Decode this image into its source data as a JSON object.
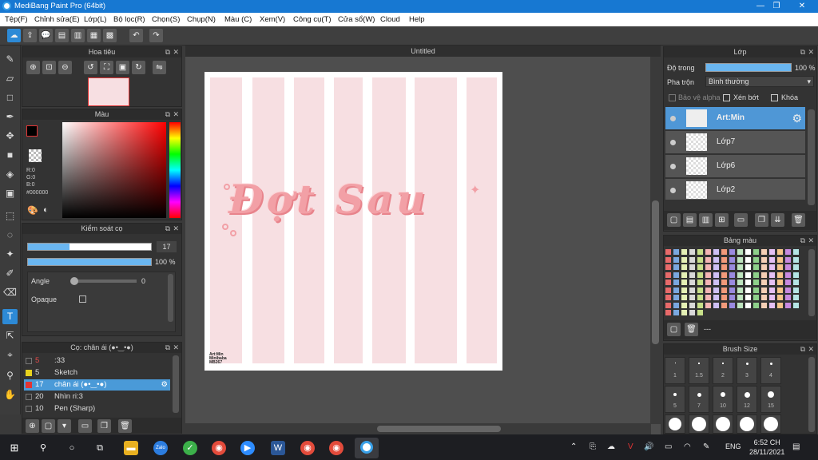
{
  "window": {
    "title": "MediBang Paint Pro (64bit)",
    "min": "—",
    "max": "❐",
    "close": "✕"
  },
  "menu": [
    "Tệp(F)",
    "Chỉnh sửa(E)",
    "Lớp(L)",
    "Bộ lọc(R)",
    "Chọn(S)",
    "Chụp(N)",
    "Màu (C)",
    "Xem(V)",
    "Công cụ(T)",
    "Cửa sổ(W)",
    "Cloud",
    "Help"
  ],
  "toolbar_icons": [
    "cloud-icon",
    "share-icon",
    "chat-icon",
    "comment-icon",
    "document-icon",
    "gallery-icon",
    "grid-icon",
    "undo-icon",
    "redo-icon"
  ],
  "navigator": {
    "title": "Hoa tiêu"
  },
  "color": {
    "title": "Màu",
    "r": "R:0",
    "g": "G:0",
    "b": "B:0",
    "hex": "#000000"
  },
  "brush_control": {
    "title": "Kiểm soát cọ",
    "size": "17",
    "opacity": "100 %",
    "angle_label": "Angle",
    "angle_value": "0",
    "opaque_label": "Opaque"
  },
  "brush_list": {
    "title": "Cọ: chân ái (●•‿•●)",
    "items": [
      {
        "size": "5",
        "name": ":33",
        "color": "#333333"
      },
      {
        "size": "5",
        "name": "Sketch",
        "color": "#e8d21e"
      },
      {
        "size": "17",
        "name": "chân ái (●•‿•●)",
        "color": "#e23434"
      },
      {
        "size": "20",
        "name": "Nhìn ri:3",
        "color": "#333333"
      },
      {
        "size": "10",
        "name": "Pen (Sharp)",
        "color": "#333333"
      }
    ]
  },
  "canvas": {
    "title": "Untitled",
    "art_text": "Đợt Sau",
    "signature": "Art:Min\nMinibaba\nMB267"
  },
  "layers": {
    "title": "Lớp",
    "opacity_label": "Độ trong",
    "opacity_value": "100 %",
    "blend_label": "Pha trộn",
    "blend_value": "Bình thường",
    "alpha_protect": "Bảo vệ alpha",
    "clipping": "Xén bớt",
    "lock": "Khóa",
    "items": [
      "Art:Min",
      "Lớp7",
      "Lớp6",
      "Lớp2"
    ]
  },
  "palette": {
    "title": "Bảng màu",
    "footer": "---"
  },
  "brush_size": {
    "title": "Brush Size",
    "sizes": [
      "1",
      "1.5",
      "2",
      "3",
      "4",
      "5",
      "7",
      "10",
      "12",
      "15"
    ]
  },
  "taskbar": {
    "time": "6:52 CH",
    "date": "28/11/2021",
    "lang": "ENG"
  }
}
